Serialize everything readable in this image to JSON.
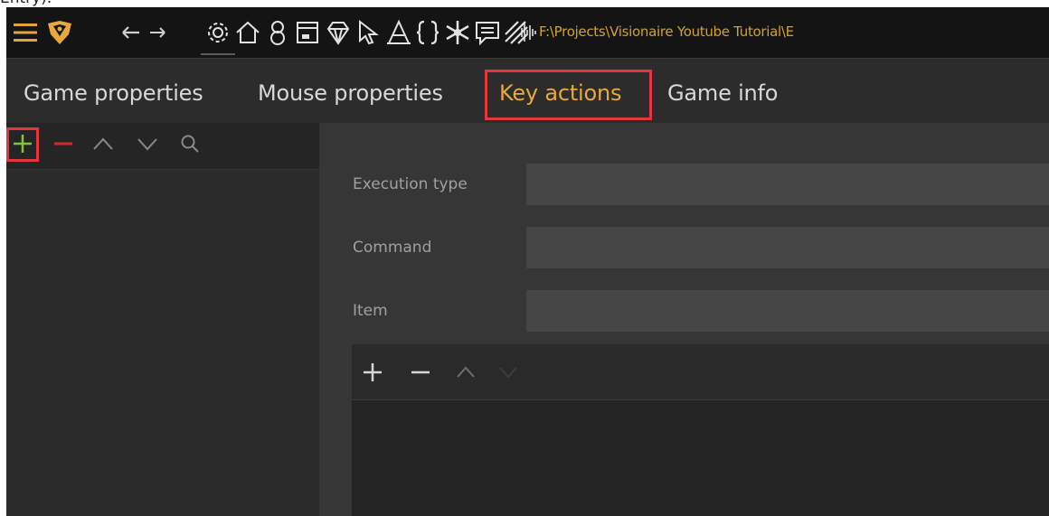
{
  "caption_fragment": "Entry).",
  "toolbar": {
    "icons": [
      "menu-icon",
      "logo-icon",
      "back-arrow-icon",
      "forward-arrow-icon",
      "gear-icon",
      "home-icon",
      "characters-icon",
      "interface-icon",
      "gem-icon",
      "cursor-icon",
      "font-icon",
      "script-braces-icon",
      "particles-icon",
      "dialog-icon",
      "shader-icon",
      "audio-icon"
    ],
    "project_path": "F:\\Projects\\Visionaire Youtube Tutorial\\E"
  },
  "tabs": [
    {
      "label": "Game properties",
      "active": false
    },
    {
      "label": "Mouse properties",
      "active": false
    },
    {
      "label": "Key actions",
      "active": true
    },
    {
      "label": "Game info",
      "active": false
    }
  ],
  "left_toolbar": {
    "buttons": [
      "add-icon",
      "remove-icon",
      "move-up-icon",
      "move-down-icon",
      "search-icon"
    ]
  },
  "form": {
    "execution_type_label": "Execution type",
    "execution_type_value": "",
    "command_label": "Command",
    "command_value": "",
    "item_label": "Item",
    "item_value": ""
  },
  "sub_toolbar": {
    "buttons": [
      "add-icon",
      "remove-icon",
      "move-up-icon",
      "move-down-icon"
    ]
  },
  "colors": {
    "accent": "#e9a93a",
    "highlight": "#e5363f",
    "add_green": "#7ec63b",
    "remove_red": "#d8262d"
  }
}
